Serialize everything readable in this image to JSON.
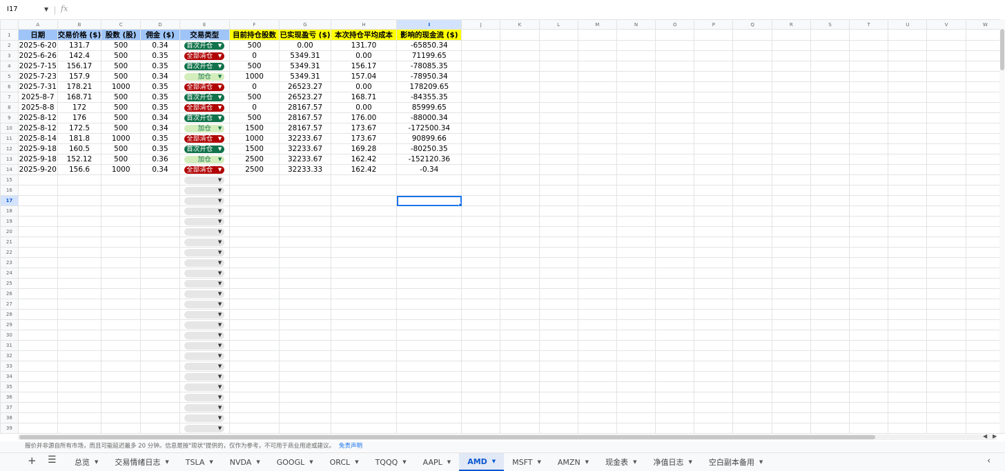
{
  "formula_bar": {
    "name_box": "I17",
    "fx": "fx",
    "formula": ""
  },
  "columns": [
    "A",
    "B",
    "C",
    "D",
    "E",
    "F",
    "G",
    "H",
    "I",
    "J",
    "K",
    "L",
    "M",
    "N",
    "O",
    "P",
    "Q",
    "R",
    "S",
    "T",
    "U",
    "V",
    "W"
  ],
  "selected_column": "I",
  "selected_row": 17,
  "headers": [
    "日期",
    "交易价格 ($)",
    "股数 (股)",
    "佣金 ($)",
    "交易类型",
    "目前持仓股数",
    "已实现盈亏 ($)",
    "本次持仓平均成本",
    "影响的现金流 ($)"
  ],
  "rows": [
    [
      "2025-6-20",
      "131.7",
      "500",
      "0.34",
      "首次开仓",
      "500",
      "0.00",
      "131.70",
      "-65850.34"
    ],
    [
      "2025-6-26",
      "142.4",
      "500",
      "0.35",
      "全部清仓",
      "0",
      "5349.31",
      "0.00",
      "71199.65"
    ],
    [
      "2025-7-15",
      "156.17",
      "500",
      "0.35",
      "首次开仓",
      "500",
      "5349.31",
      "156.17",
      "-78085.35"
    ],
    [
      "2025-7-23",
      "157.9",
      "500",
      "0.34",
      "加仓",
      "1000",
      "5349.31",
      "157.04",
      "-78950.34"
    ],
    [
      "2025-7-31",
      "178.21",
      "1000",
      "0.35",
      "全部清仓",
      "0",
      "26523.27",
      "0.00",
      "178209.65"
    ],
    [
      "2025-8-7",
      "168.71",
      "500",
      "0.35",
      "首次开仓",
      "500",
      "26523.27",
      "168.71",
      "-84355.35"
    ],
    [
      "2025-8-8",
      "172",
      "500",
      "0.35",
      "全部清仓",
      "0",
      "28167.57",
      "0.00",
      "85999.65"
    ],
    [
      "2025-8-12",
      "176",
      "500",
      "0.34",
      "首次开仓",
      "500",
      "28167.57",
      "176.00",
      "-88000.34"
    ],
    [
      "2025-8-12",
      "172.5",
      "500",
      "0.34",
      "加仓",
      "1500",
      "28167.57",
      "173.67",
      "-172500.34"
    ],
    [
      "2025-8-14",
      "181.8",
      "1000",
      "0.35",
      "全部清仓",
      "1000",
      "32233.67",
      "173.67",
      "90899.66"
    ],
    [
      "2025-9-18",
      "160.5",
      "500",
      "0.35",
      "首次开仓",
      "1500",
      "32233.67",
      "169.28",
      "-80250.35"
    ],
    [
      "2025-9-18",
      "152.12",
      "500",
      "0.36",
      "加仓",
      "2500",
      "32233.67",
      "162.42",
      "-152120.36"
    ],
    [
      "2025-9-20",
      "156.6",
      "1000",
      "0.34",
      "全部清仓",
      "2500",
      "32233.33",
      "162.42",
      "-0.34"
    ]
  ],
  "chip_types": {
    "首次开仓": "open",
    "全部清仓": "close",
    "加仓": "add"
  },
  "colors": {
    "header_blue": "#9fc5f8",
    "header_yellow": "#ffff00",
    "open_chip": "#11734b",
    "close_chip": "#b10202",
    "add_chip": "#d4edbc",
    "selection": "#1a73e8"
  },
  "total_rows": 39,
  "footnote": {
    "text": "报价并非源自所有市场，而且可能延迟最多 20 分钟。信息是按\"现状\"提供的，仅作为参考，不可用于商业用途或建议。",
    "link": "免责声明"
  },
  "sheet_tabs": [
    "总览",
    "交易情绪日志",
    "TSLA",
    "NVDA",
    "GOOGL",
    "ORCL",
    "TQQQ",
    "AAPL",
    "AMD",
    "MSFT",
    "AMZN",
    "现金表",
    "净值日志",
    "空白副本备用"
  ],
  "active_tab": "AMD",
  "icons": {
    "add_sheet": "plus-icon",
    "all_sheets": "menu-icon",
    "dropdown": "caret-down-icon",
    "tabs_scroll": "chevron-left-icon"
  }
}
